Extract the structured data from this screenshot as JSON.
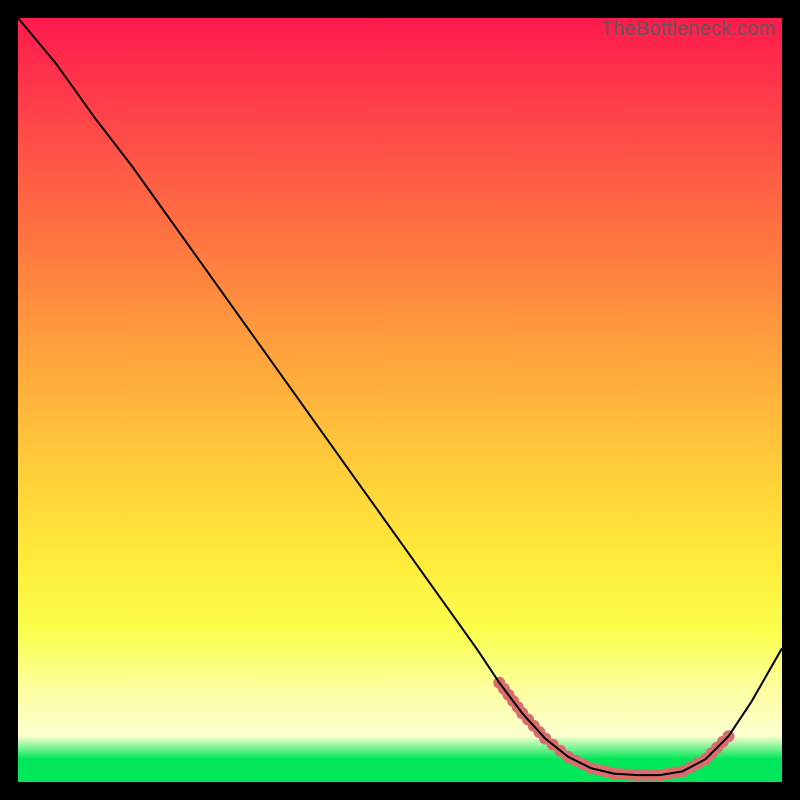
{
  "watermark": "TheBottleneck.com",
  "chart_data": {
    "type": "line",
    "title": "",
    "xlabel": "",
    "ylabel": "",
    "xlim": [
      0,
      100
    ],
    "ylim": [
      0,
      100
    ],
    "series": [
      {
        "name": "black-curve",
        "color": "#000000",
        "stroke_width": 2,
        "x": [
          0,
          5,
          10,
          15,
          20,
          25,
          30,
          35,
          40,
          45,
          50,
          55,
          60,
          63,
          66,
          69,
          72,
          75,
          78,
          81,
          84,
          87,
          90,
          93,
          96,
          100
        ],
        "y": [
          100,
          94,
          87,
          80.5,
          73.5,
          66.5,
          59.5,
          52.5,
          45.5,
          38.5,
          31.5,
          24.5,
          17.5,
          13,
          9,
          5.7,
          3.3,
          1.8,
          1.1,
          0.9,
          0.9,
          1.4,
          3.0,
          6.0,
          10.5,
          17.5
        ]
      },
      {
        "name": "pink-highlight",
        "color": "#d96d6d",
        "stroke_width": 12,
        "x": [
          63,
          66,
          69,
          72,
          75,
          78,
          81,
          84,
          87,
          90,
          93
        ],
        "y": [
          13,
          9,
          5.7,
          3.3,
          1.8,
          1.1,
          0.9,
          0.9,
          1.4,
          3.0,
          6.0
        ],
        "dotted": true
      }
    ]
  }
}
